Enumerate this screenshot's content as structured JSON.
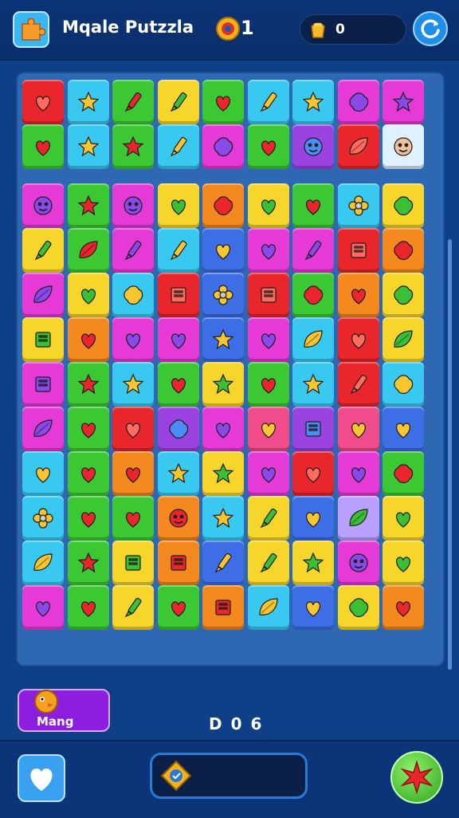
{
  "header": {
    "title": "Mqale Putzzla",
    "coin_count": "1",
    "gem_count": "0",
    "logo_icon": "puzzle-piece-icon",
    "coin_icon": "coin-icon",
    "gem_icon": "gem-bag-icon",
    "refresh_icon": "refresh-icon"
  },
  "board": {
    "columns": 9,
    "rows": 13,
    "colors": {
      "R": "#e8262b",
      "C": "#39c9f0",
      "G": "#3cc832",
      "Y": "#f7d62c",
      "P": "#e53ad6",
      "B": "#3d6ee6",
      "O": "#f4891f",
      "V": "#9a43e0",
      "K": "#f04b8b",
      "L": "#b9a0ff",
      "W": "#dff1ff"
    },
    "rows_data": [
      [
        [
          "R",
          "heart"
        ],
        [
          "C",
          "star"
        ],
        [
          "G",
          "pen"
        ],
        [
          "Y",
          "pen"
        ],
        [
          "G",
          "heart"
        ],
        [
          "C",
          "pen"
        ],
        [
          "C",
          "star"
        ],
        [
          "P",
          "blob"
        ],
        [
          "P",
          "star"
        ]
      ],
      [
        [
          "G",
          "heart"
        ],
        [
          "C",
          "star"
        ],
        [
          "G",
          "star"
        ],
        [
          "C",
          "pen"
        ],
        [
          "P",
          "blob"
        ],
        [
          "G",
          "heart"
        ],
        [
          "V",
          "face"
        ],
        [
          "R",
          "leaf"
        ],
        [
          "W",
          "face"
        ]
      ],
      [
        [
          "P",
          "face"
        ],
        [
          "G",
          "star"
        ],
        [
          "P",
          "face"
        ],
        [
          "Y",
          "heart"
        ],
        [
          "O",
          "blob"
        ],
        [
          "Y",
          "heart"
        ],
        [
          "G",
          "heart"
        ],
        [
          "C",
          "flower"
        ],
        [
          "Y",
          "blob"
        ]
      ],
      [
        [
          "Y",
          "pen"
        ],
        [
          "G",
          "leaf"
        ],
        [
          "P",
          "pen"
        ],
        [
          "C",
          "pen"
        ],
        [
          "B",
          "heart"
        ],
        [
          "P",
          "heart"
        ],
        [
          "P",
          "pen"
        ],
        [
          "R",
          "box"
        ],
        [
          "O",
          "blob"
        ]
      ],
      [
        [
          "P",
          "leaf"
        ],
        [
          "Y",
          "heart"
        ],
        [
          "C",
          "blob"
        ],
        [
          "R",
          "box"
        ],
        [
          "B",
          "flower"
        ],
        [
          "R",
          "box"
        ],
        [
          "G",
          "blob"
        ],
        [
          "O",
          "heart"
        ],
        [
          "Y",
          "blob"
        ]
      ],
      [
        [
          "Y",
          "box"
        ],
        [
          "O",
          "heart"
        ],
        [
          "P",
          "heart"
        ],
        [
          "P",
          "heart"
        ],
        [
          "B",
          "star"
        ],
        [
          "P",
          "heart"
        ],
        [
          "C",
          "leaf"
        ],
        [
          "R",
          "heart"
        ],
        [
          "Y",
          "leaf"
        ]
      ],
      [
        [
          "P",
          "box"
        ],
        [
          "G",
          "star"
        ],
        [
          "C",
          "star"
        ],
        [
          "G",
          "heart"
        ],
        [
          "Y",
          "star"
        ],
        [
          "G",
          "heart"
        ],
        [
          "C",
          "star"
        ],
        [
          "R",
          "pen"
        ],
        [
          "C",
          "blob"
        ]
      ],
      [
        [
          "P",
          "leaf"
        ],
        [
          "G",
          "heart"
        ],
        [
          "R",
          "heart"
        ],
        [
          "V",
          "blob"
        ],
        [
          "P",
          "heart"
        ],
        [
          "K",
          "heart"
        ],
        [
          "V",
          "box"
        ],
        [
          "K",
          "heart"
        ],
        [
          "B",
          "heart"
        ]
      ],
      [
        [
          "C",
          "heart"
        ],
        [
          "G",
          "heart"
        ],
        [
          "O",
          "heart"
        ],
        [
          "C",
          "star"
        ],
        [
          "Y",
          "star"
        ],
        [
          "P",
          "heart"
        ],
        [
          "R",
          "heart"
        ],
        [
          "P",
          "heart"
        ],
        [
          "G",
          "blob"
        ]
      ],
      [
        [
          "C",
          "flower"
        ],
        [
          "G",
          "heart"
        ],
        [
          "G",
          "heart"
        ],
        [
          "O",
          "face"
        ],
        [
          "C",
          "star"
        ],
        [
          "Y",
          "pen"
        ],
        [
          "B",
          "heart"
        ],
        [
          "L",
          "leaf"
        ],
        [
          "Y",
          "heart"
        ]
      ],
      [
        [
          "C",
          "leaf"
        ],
        [
          "G",
          "star"
        ],
        [
          "Y",
          "box"
        ],
        [
          "O",
          "box"
        ],
        [
          "B",
          "pen"
        ],
        [
          "Y",
          "pen"
        ],
        [
          "Y",
          "star"
        ],
        [
          "P",
          "face"
        ],
        [
          "Y",
          "heart"
        ]
      ],
      [
        [
          "P",
          "heart"
        ],
        [
          "G",
          "heart"
        ],
        [
          "Y",
          "pen"
        ],
        [
          "G",
          "heart"
        ],
        [
          "O",
          "box"
        ],
        [
          "C",
          "leaf"
        ],
        [
          "B",
          "heart"
        ],
        [
          "Y",
          "blob"
        ],
        [
          "O",
          "heart"
        ]
      ]
    ]
  },
  "footer": {
    "mang_label": "Mang",
    "mang_icon": "chick-icon",
    "moves_text": "D 0 6",
    "heart_icon": "heart-icon",
    "bar_icon": "badge-icon",
    "star_icon": "star-icon"
  }
}
